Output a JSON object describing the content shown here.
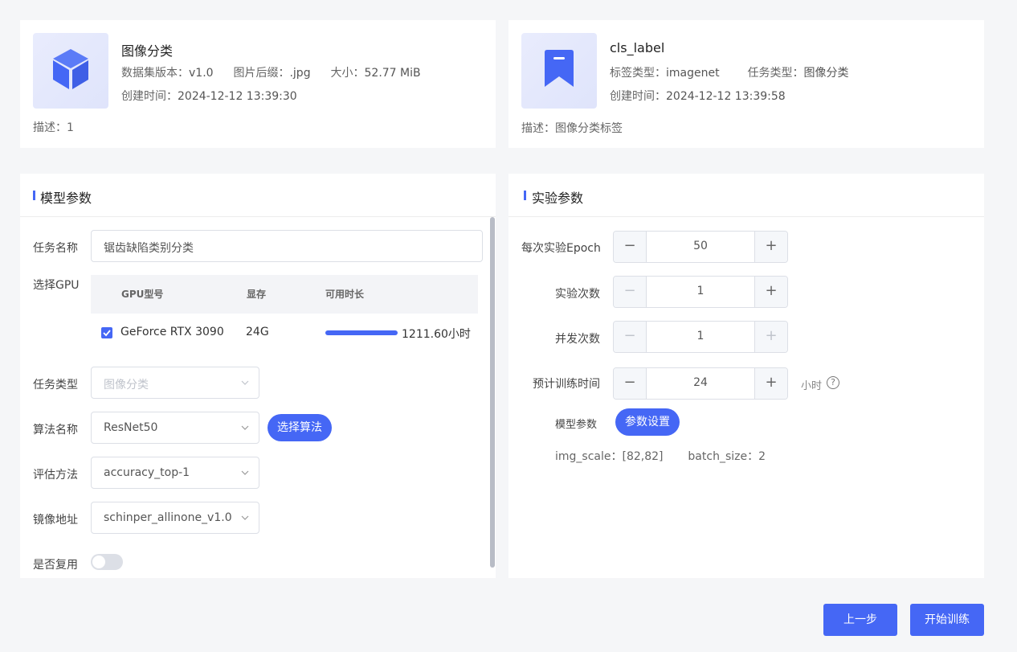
{
  "dataset_card": {
    "name": "图像分类",
    "version_label": "数据集版本：",
    "version": "v1.0",
    "suffix_label": "图片后缀：",
    "suffix": ".jpg",
    "size_label": "大小：",
    "size": "52.77 MiB",
    "created_label": "创建时间：",
    "created": "2024-12-12 13:39:30",
    "desc_label": "描述：",
    "desc": "1",
    "icon": "cube-icon"
  },
  "label_card": {
    "name": "cls_label",
    "type_label": "标签类型：",
    "type": "imagenet",
    "task_label": "任务类型：",
    "task": "图像分类",
    "created_label": "创建时间：",
    "created": "2024-12-12 13:39:58",
    "desc_label": "描述：",
    "desc": "图像分类标签",
    "icon": "bookmark-icon"
  },
  "model_params": {
    "title": "模型参数",
    "task_name_label": "任务名称",
    "task_name": "锯齿缺陷类别分类",
    "gpu_label": "选择GPU",
    "gpu_columns": [
      "GPU型号",
      "显存",
      "可用时长"
    ],
    "gpu_rows": [
      {
        "model": "GeForce RTX 3090",
        "memory": "24G",
        "duration": "1211.60小时",
        "checked": true,
        "availability_fraction": 1.0
      }
    ],
    "task_type_label": "任务类型",
    "task_type": "图像分类",
    "algo_label": "算法名称",
    "algo": "ResNet50",
    "select_algo_button": "选择算法",
    "eval_label": "评估方法",
    "eval": "accuracy_top-1",
    "image_label": "镜像地址",
    "image": "schinper_allinone_v1.0",
    "reuse_label": "是否复用",
    "reuse": false
  },
  "experiment_params": {
    "title": "实验参数",
    "epoch_label": "每次实验Epoch",
    "epoch": "50",
    "runs_label": "实验次数",
    "runs": "1",
    "concurrency_label": "并发次数",
    "concurrency": "1",
    "est_time_label": "预计训练时间",
    "est_time": "24",
    "est_time_unit": "小时",
    "help_glyph": "?",
    "model_param_label": "模型参数",
    "param_settings_button": "参数设置",
    "img_scale_label": "img_scale：",
    "img_scale": "[82,82]",
    "batch_size_label": "batch_size：",
    "batch_size": "2",
    "minus_glyph": "−",
    "plus_glyph": "+"
  },
  "footer": {
    "prev_button": "上一步",
    "start_button": "开始训练"
  },
  "colors": {
    "accent": "#4567f5",
    "background": "#f5f6f8"
  }
}
